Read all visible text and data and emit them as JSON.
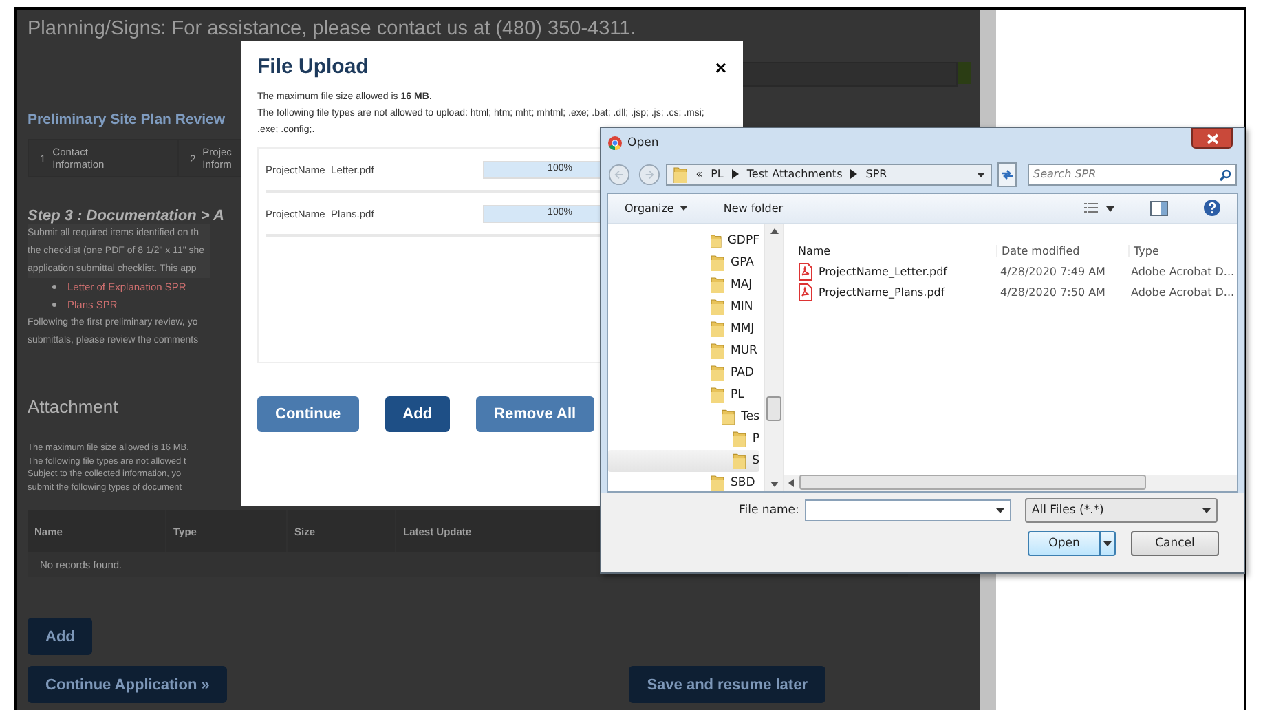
{
  "page": {
    "contact_line": "Planning/Signs: For assistance, please contact us at (480) 350-4311.",
    "section_title": "Preliminary Site Plan Review",
    "steps": [
      {
        "number": "1",
        "label": "Contact Information"
      },
      {
        "number": "2",
        "label": "Projec Inform"
      }
    ],
    "step_heading": "Step 3 : Documentation > A",
    "instructions": [
      "Submit all required items identified on th",
      "the checklist (one PDF of 8 1/2\" x 11\" she",
      "application submittal checklist.  This app"
    ],
    "links": [
      "Letter of Explanation SPR",
      "Plans SPR"
    ],
    "followup": [
      "Following the first preliminary review, yo",
      "submittals, please review the comments"
    ],
    "attachment_title": "Attachment",
    "attachment_notes": [
      "The maximum file size allowed is 16 MB.",
      "The following file types are not allowed t",
      "Subject to the collected information, yo",
      "submit the following types of document"
    ],
    "table": {
      "columns": [
        "Name",
        "Type",
        "Size",
        "Latest Update"
      ],
      "empty_text": "No records found."
    },
    "add_button": "Add",
    "continue_button": "Continue Application »",
    "save_button": "Save and resume later"
  },
  "upload_dialog": {
    "title": "File Upload",
    "close": "×",
    "size_note": "The maximum file size allowed is **16 MB**.",
    "types_note": "The following file types are not allowed to upload: html; htm; mht; mhtml; .exe; .bat; .dll; .jsp; .js; .cs; .msi; .exe; .config;.",
    "files": [
      {
        "name": "ProjectName_Letter.pdf",
        "level": 1,
        "percent": "100%"
      },
      {
        "name": "ProjectName_Plans.pdf",
        "level": 1,
        "percent": "100%"
      }
    ],
    "buttons": [
      {
        "label": "Continue",
        "kind": "secondary"
      },
      {
        "label": "Add",
        "kind": "primary"
      },
      {
        "label": "Remove All",
        "kind": "secondary"
      }
    ]
  },
  "open_dialog": {
    "title": "Open",
    "breadcrumb": {
      "overflow": "«",
      "path": [
        "PL",
        "Test Attachments",
        "SPR"
      ]
    },
    "search": {
      "placeholder": "Search SPR"
    },
    "toolbar": {
      "organize": "Organize",
      "new_folder": "New folder"
    },
    "tree": [
      {
        "label": "GDPF",
        "selected": false
      },
      {
        "label": "GPA",
        "selected": false
      },
      {
        "label": "MAJ",
        "selected": false
      },
      {
        "label": "MIN",
        "selected": false
      },
      {
        "label": "MMJ",
        "selected": false
      },
      {
        "label": "MUR",
        "selected": false
      },
      {
        "label": "PAD",
        "selected": false
      },
      {
        "label": "PL",
        "selected": false,
        "children": [
          {
            "label": "Tes",
            "selected": false,
            "children": [
              {
                "label": "P",
                "selected": false
              },
              {
                "label": "S",
                "selected": true
              }
            ]
          }
        ]
      },
      {
        "label": "SBD",
        "selected": false
      }
    ],
    "columns": [
      "Name",
      "Date modified",
      "Type"
    ],
    "files": [
      {
        "name": "ProjectName_Letter.pdf",
        "date": "4/28/2020 7:49 AM",
        "type": "Adobe Acrobat D..."
      },
      {
        "name": "ProjectName_Plans.pdf",
        "date": "4/28/2020 7:50 AM",
        "type": "Adobe Acrobat D..."
      }
    ],
    "file_name_label": "File name:",
    "file_type": "All Files (*.*)",
    "open_button": "Open",
    "cancel_button": "Cancel"
  }
}
